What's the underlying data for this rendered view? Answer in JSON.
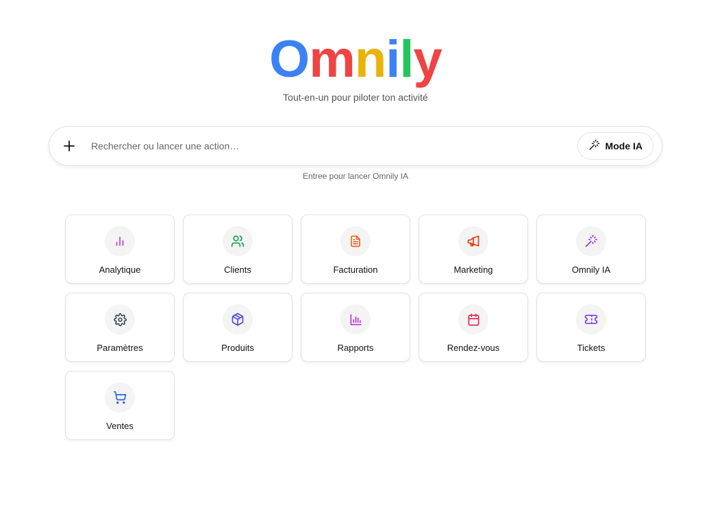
{
  "brand": {
    "letters": [
      {
        "char": "O",
        "color": "#3b82f6"
      },
      {
        "char": "m",
        "color": "#ef4444"
      },
      {
        "char": "n",
        "color": "#eab308"
      },
      {
        "char": "i",
        "color": "#3b82f6"
      },
      {
        "char": "l",
        "color": "#22c55e"
      },
      {
        "char": "y",
        "color": "#ef4444"
      }
    ],
    "tagline": "Tout-en-un pour piloter ton activité"
  },
  "search": {
    "placeholder": "Rechercher ou lancer une action…",
    "value": "",
    "add_icon": "plus-icon",
    "mode_button_label": "Mode IA",
    "mode_button_icon": "magic-wand-icon",
    "hint": "Entree pour lancer Omnily IA"
  },
  "apps": [
    {
      "label": "Analytique",
      "icon": "bar-chart-icon",
      "color": "#c026d3"
    },
    {
      "label": "Clients",
      "icon": "users-icon",
      "color": "#16a34a"
    },
    {
      "label": "Facturation",
      "icon": "document-icon",
      "color": "#ea580c"
    },
    {
      "label": "Marketing",
      "icon": "megaphone-icon",
      "color": "#ea3a0c"
    },
    {
      "label": "Omnily IA",
      "icon": "magic-wand-icon",
      "color": "#9333ea"
    },
    {
      "label": "Paramètres",
      "icon": "gear-icon",
      "color": "#334155"
    },
    {
      "label": "Produits",
      "icon": "box-icon",
      "color": "#4f46e5"
    },
    {
      "label": "Rapports",
      "icon": "report-chart-icon",
      "color": "#c026d3"
    },
    {
      "label": "Rendez-vous",
      "icon": "calendar-icon",
      "color": "#e11d48"
    },
    {
      "label": "Tickets",
      "icon": "ticket-icon",
      "color": "#7c3aed"
    },
    {
      "label": "Ventes",
      "icon": "cart-icon",
      "color": "#2563eb"
    }
  ]
}
